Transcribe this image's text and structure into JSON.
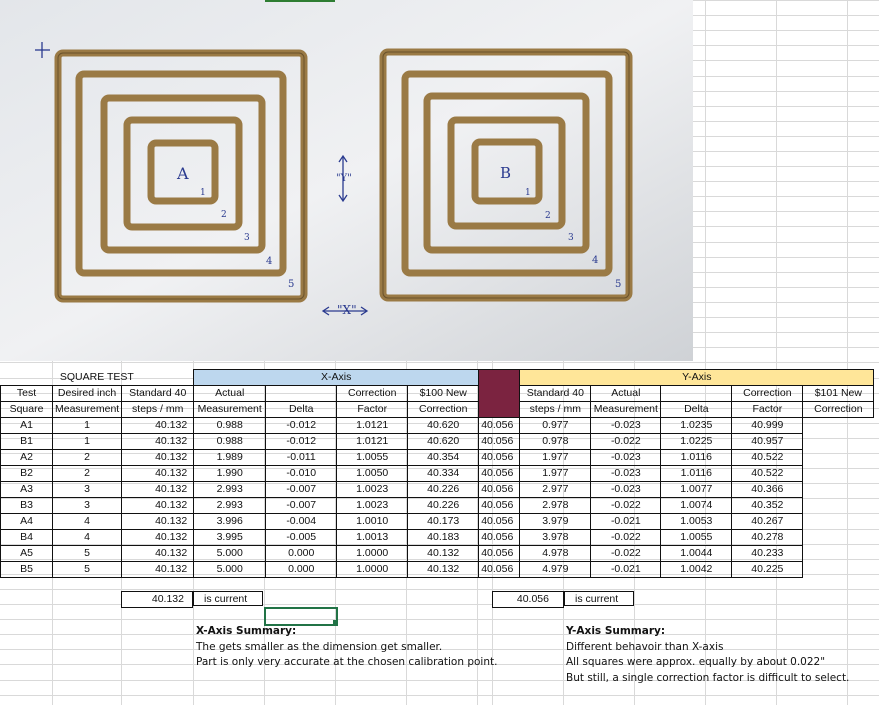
{
  "photo": {
    "label_a": "A",
    "label_b": "B",
    "y_marker": "\"Y\"",
    "x_marker": "\"X\"",
    "ring_numbers": [
      "1",
      "2",
      "3",
      "4",
      "5"
    ]
  },
  "table": {
    "title": "SQUARE TEST",
    "x_axis_header": "X-Axis",
    "y_axis_header": "Y-Axis",
    "columns_left": [
      [
        "Test",
        "Square"
      ],
      [
        "Desired inch",
        "Measurement"
      ],
      [
        "Standard 40",
        "steps / mm"
      ]
    ],
    "columns_x": [
      [
        "Actual",
        "Measurement"
      ],
      [
        "",
        "Delta"
      ],
      [
        "Correction",
        "Factor"
      ],
      [
        "$100 New",
        "Correction"
      ]
    ],
    "columns_y": [
      [
        "Standard 40",
        "steps / mm"
      ],
      [
        "Actual",
        "Measurement"
      ],
      [
        "",
        "Delta"
      ],
      [
        "Correction",
        "Factor"
      ],
      [
        "$101 New",
        "Correction"
      ]
    ],
    "rows": [
      [
        "A1",
        "1",
        "40.132",
        "0.988",
        "-0.012",
        "1.0121",
        "40.620",
        "40.056",
        "0.977",
        "-0.023",
        "1.0235",
        "40.999"
      ],
      [
        "B1",
        "1",
        "40.132",
        "0.988",
        "-0.012",
        "1.0121",
        "40.620",
        "40.056",
        "0.978",
        "-0.022",
        "1.0225",
        "40.957"
      ],
      [
        "A2",
        "2",
        "40.132",
        "1.989",
        "-0.011",
        "1.0055",
        "40.354",
        "40.056",
        "1.977",
        "-0.023",
        "1.0116",
        "40.522"
      ],
      [
        "B2",
        "2",
        "40.132",
        "1.990",
        "-0.010",
        "1.0050",
        "40.334",
        "40.056",
        "1.977",
        "-0.023",
        "1.0116",
        "40.522"
      ],
      [
        "A3",
        "3",
        "40.132",
        "2.993",
        "-0.007",
        "1.0023",
        "40.226",
        "40.056",
        "2.977",
        "-0.023",
        "1.0077",
        "40.366"
      ],
      [
        "B3",
        "3",
        "40.132",
        "2.993",
        "-0.007",
        "1.0023",
        "40.226",
        "40.056",
        "2.978",
        "-0.022",
        "1.0074",
        "40.352"
      ],
      [
        "A4",
        "4",
        "40.132",
        "3.996",
        "-0.004",
        "1.0010",
        "40.173",
        "40.056",
        "3.979",
        "-0.021",
        "1.0053",
        "40.267"
      ],
      [
        "B4",
        "4",
        "40.132",
        "3.995",
        "-0.005",
        "1.0013",
        "40.183",
        "40.056",
        "3.978",
        "-0.022",
        "1.0055",
        "40.278"
      ],
      [
        "A5",
        "5",
        "40.132",
        "5.000",
        "0.000",
        "1.0000",
        "40.132",
        "40.056",
        "4.978",
        "-0.022",
        "1.0044",
        "40.233"
      ],
      [
        "B5",
        "5",
        "40.132",
        "5.000",
        "0.000",
        "1.0000",
        "40.132",
        "40.056",
        "4.979",
        "-0.021",
        "1.0042",
        "40.225"
      ]
    ]
  },
  "current": {
    "x_value": "40.132",
    "x_label": "is current",
    "y_value": "40.056",
    "y_label": "is current"
  },
  "summary_x": {
    "title": "X-Axis Summary:",
    "line1": "The gets smaller as the dimension get smaller.",
    "line2": "Part is only very accurate at the chosen calibration point."
  },
  "summary_y": {
    "title": "Y-Axis Summary:",
    "line1": "Different behavoir than X-axis",
    "line2": "All squares were approx. equally by about 0.022\"",
    "line3": "But still, a single correction factor is difficult to select."
  },
  "colors": {
    "x_header": "#bdd7ee",
    "y_header": "#ffe699",
    "divider": "#7b2340",
    "selection": "#217346"
  }
}
